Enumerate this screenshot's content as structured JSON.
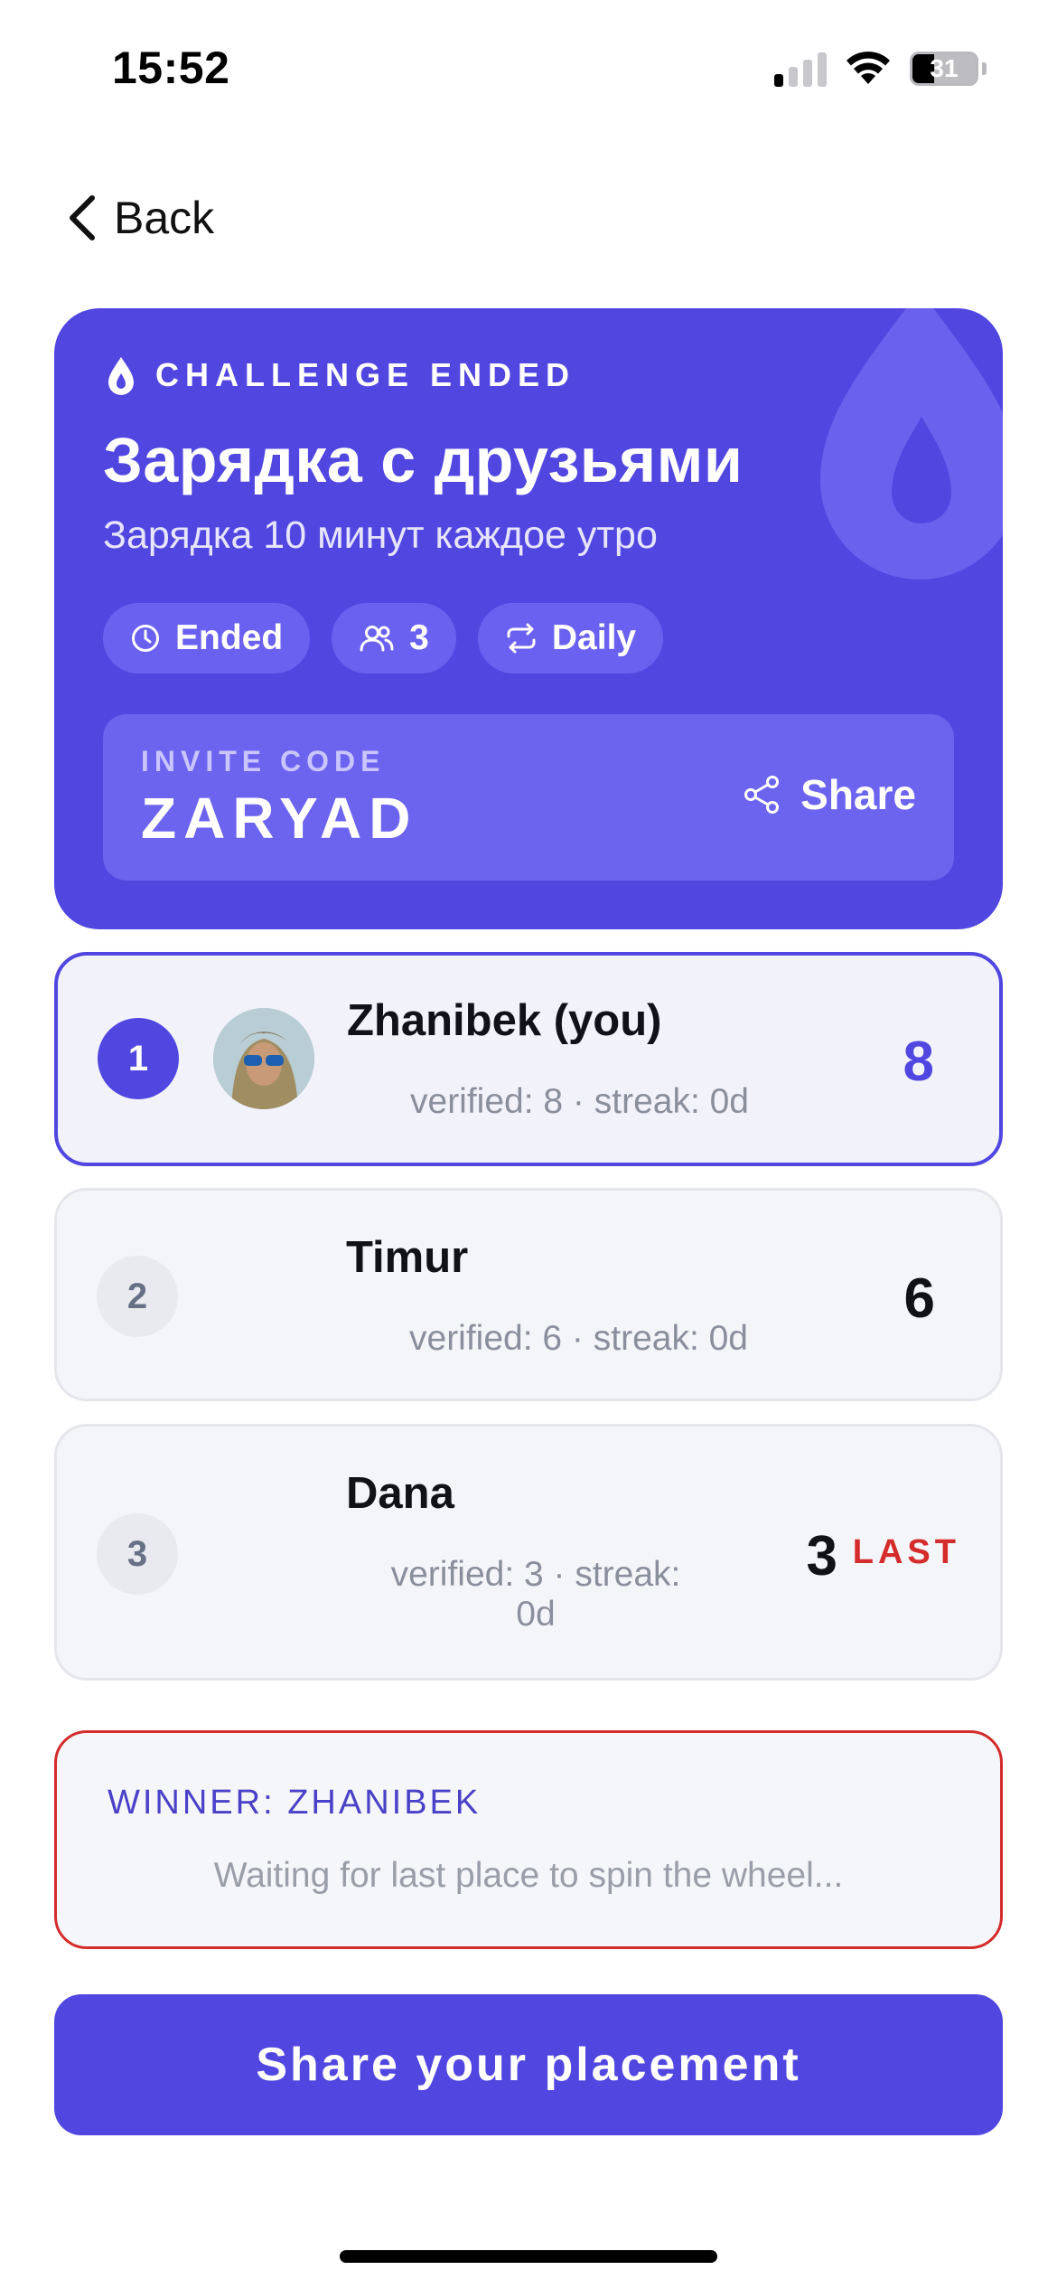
{
  "status_bar": {
    "time": "15:52",
    "battery": "31"
  },
  "nav": {
    "back_label": "Back"
  },
  "hero": {
    "eyebrow": "CHALLENGE ENDED",
    "title": "Зарядка с друзьями",
    "subtitle": "Зарядка 10 минут каждое утро",
    "chips": {
      "status": "Ended",
      "participants": "3",
      "frequency": "Daily"
    },
    "invite": {
      "label": "INVITE CODE",
      "code": "ZARYAD",
      "share_label": "Share"
    }
  },
  "leaderboard": [
    {
      "rank": "1",
      "name": "Zhanibek (you)",
      "meta": "verified: 8 · streak: 0d",
      "score": "8",
      "is_me": true
    },
    {
      "rank": "2",
      "name": "Timur",
      "meta": "verified: 6 · streak: 0d",
      "score": "6"
    },
    {
      "rank": "3",
      "name": "Dana",
      "meta_line1": "verified: 3 · streak:",
      "meta_line2": "0d",
      "score": "3",
      "badge": "LAST"
    }
  ],
  "result": {
    "winner_label": "WINNER: ZHANIBEK",
    "status_text": "Waiting for last place to spin the wheel..."
  },
  "cta": {
    "label": "Share your placement"
  },
  "colors": {
    "accent": "#5147e0",
    "danger": "#d42b2b"
  }
}
